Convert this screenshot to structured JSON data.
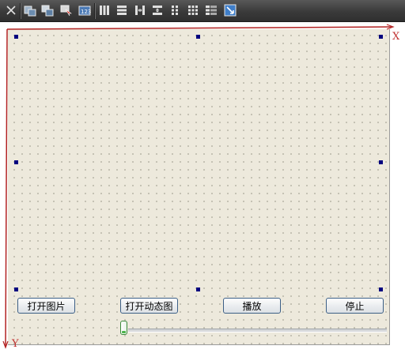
{
  "toolbar": {
    "icons": [
      "close-icon",
      "layout-widget-icon",
      "layout-split-icon",
      "edit-buddies-icon",
      "tab-order-icon",
      "layout-horizontal-icon",
      "layout-vertical-icon",
      "layout-h-splitter-icon",
      "layout-v-splitter-icon",
      "layout-grid-icon",
      "layout-form-icon",
      "break-layout-icon",
      "adjust-size-icon"
    ]
  },
  "axes": {
    "x_label": "X",
    "y_label": "Y",
    "color": "#b22222"
  },
  "form": {
    "buttons": {
      "open_image": "打开图片",
      "open_gif": "打开动态图",
      "play": "播放",
      "stop": "停止"
    },
    "slider": {
      "value": 0
    }
  },
  "colors": {
    "form_bg": "#ede9dc",
    "handle": "#00007f",
    "toolbar_bg": "#3a3a3a"
  }
}
